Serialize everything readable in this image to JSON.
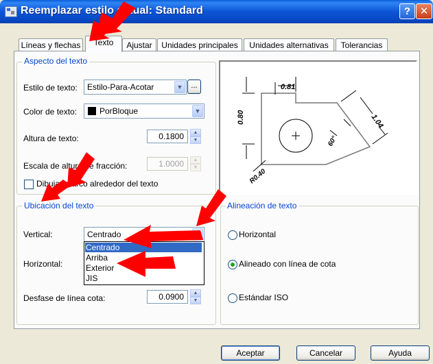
{
  "window": {
    "title": "Reemplazar estilo actual: Standard",
    "help_label": "?",
    "close_label": "✕"
  },
  "tabs": [
    {
      "label": "Líneas y flechas",
      "active": false
    },
    {
      "label": "Texto",
      "active": true
    },
    {
      "label": "Ajustar",
      "active": false
    },
    {
      "label": "Unidades principales",
      "active": false
    },
    {
      "label": "Unidades alternativas",
      "active": false
    },
    {
      "label": "Tolerancias",
      "active": false
    }
  ],
  "aspecto": {
    "group_label": "Aspecto del texto",
    "estilo": {
      "label": "Estilo de texto:",
      "value": "Estilo-Para-Acotar",
      "browse_label": "..."
    },
    "color": {
      "label": "Color de texto:",
      "value": "PorBloque",
      "swatch": "#000000"
    },
    "altura": {
      "label": "Altura de texto:",
      "value": "0.1800"
    },
    "escala": {
      "label": "Escala de altura de fracción:",
      "value": "1.0000"
    },
    "marco": {
      "label": "Dibujar marco alrededor del texto",
      "checked": false
    }
  },
  "ubicacion": {
    "group_label": "Ubicación del texto",
    "vertical": {
      "label": "Vertical:",
      "value": "Centrado",
      "options": [
        "Centrado",
        "Arriba",
        "Exterior",
        "JIS"
      ],
      "selected": "Centrado"
    },
    "horizontal": {
      "label": "Horizontal:"
    },
    "desfase": {
      "label": "Desfase de línea cota:",
      "value": "0.0900"
    }
  },
  "alineacion": {
    "group_label": "Alineación de texto",
    "options": [
      {
        "label": "Horizontal",
        "checked": false
      },
      {
        "label": "Alineado con línea de cota",
        "checked": true
      },
      {
        "label": "Estándar ISO",
        "checked": false
      }
    ]
  },
  "preview": {
    "dim_top": "0.81",
    "dim_left": "0.80",
    "dim_right": "1.04",
    "dim_angle": "60°",
    "dim_radius": "R0.40"
  },
  "buttons": {
    "ok": "Aceptar",
    "cancel": "Cancelar",
    "help": "Ayuda"
  },
  "colors": {
    "title_bar": "#0a5fd8",
    "annotation_arrow": "#ff0000",
    "group_label": "#0046d5",
    "selection": "#316ac5"
  }
}
